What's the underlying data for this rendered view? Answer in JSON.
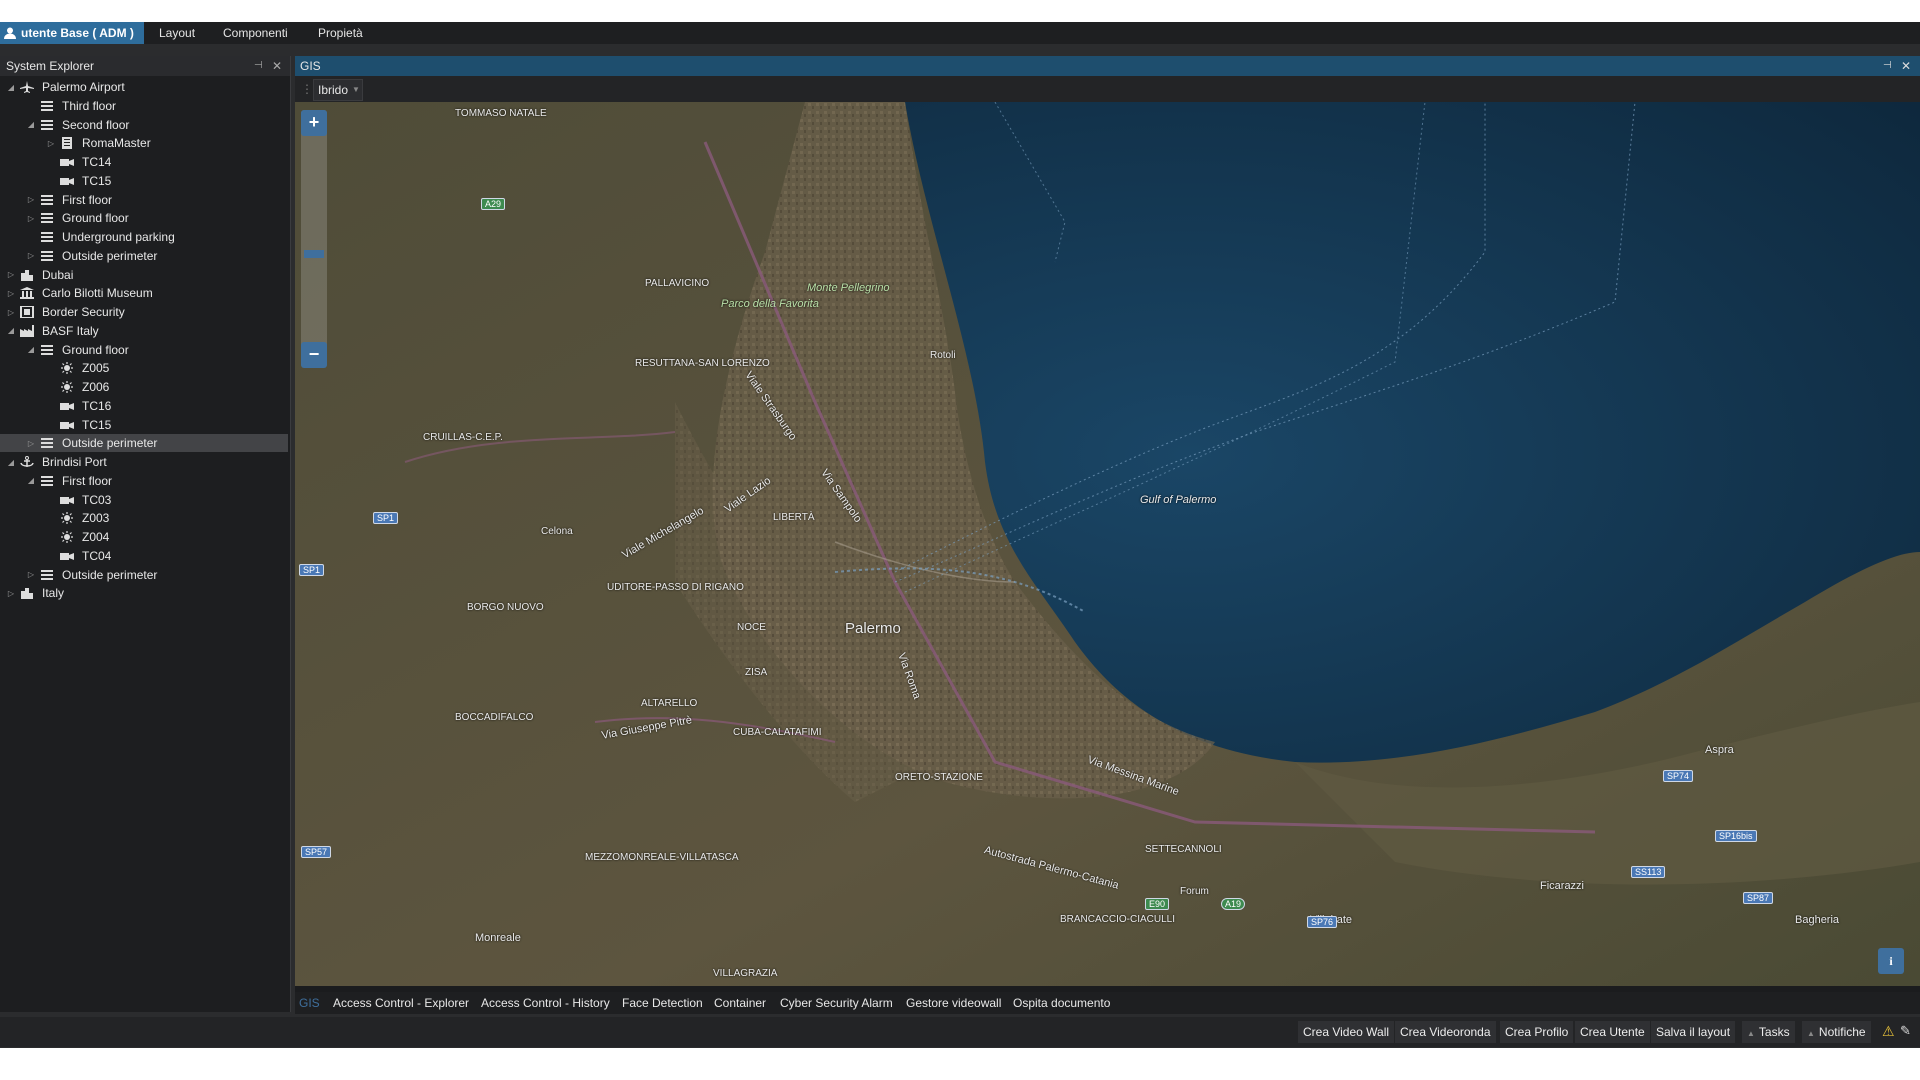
{
  "menubar": {
    "user_label": "utente  Base ( ADM )",
    "items": [
      "Layout",
      "Componenti",
      "Propietà"
    ]
  },
  "explorer": {
    "title": "System Explorer",
    "tree": [
      {
        "label": "Palermo Airport",
        "icon": "airplane-icon",
        "level": 0,
        "expanded": true
      },
      {
        "label": "Third floor",
        "icon": "floor-icon",
        "level": 1,
        "expanded": null
      },
      {
        "label": "Second floor",
        "icon": "floor-icon",
        "level": 1,
        "expanded": true
      },
      {
        "label": "RomaMaster",
        "icon": "server-icon",
        "level": 2,
        "expanded": false
      },
      {
        "label": "TC14",
        "icon": "camera-icon",
        "level": 2,
        "expanded": null
      },
      {
        "label": "TC15",
        "icon": "camera-icon",
        "level": 2,
        "expanded": null
      },
      {
        "label": "First floor",
        "icon": "floor-icon",
        "level": 1,
        "expanded": false
      },
      {
        "label": "Ground floor",
        "icon": "floor-icon",
        "level": 1,
        "expanded": false
      },
      {
        "label": "Underground parking",
        "icon": "floor-icon",
        "level": 1,
        "expanded": null
      },
      {
        "label": "Outside perimeter",
        "icon": "floor-icon",
        "level": 1,
        "expanded": false
      },
      {
        "label": "Dubai",
        "icon": "city-icon",
        "level": 0,
        "expanded": false
      },
      {
        "label": "Carlo Bilotti Museum",
        "icon": "museum-icon",
        "level": 0,
        "expanded": false
      },
      {
        "label": "Border Security",
        "icon": "border-icon",
        "level": 0,
        "expanded": false
      },
      {
        "label": "BASF Italy",
        "icon": "factory-icon",
        "level": 0,
        "expanded": true
      },
      {
        "label": "Ground floor",
        "icon": "floor-icon",
        "level": 1,
        "expanded": true
      },
      {
        "label": "Z005",
        "icon": "sensor-icon",
        "level": 2,
        "expanded": null
      },
      {
        "label": "Z006",
        "icon": "sensor-icon",
        "level": 2,
        "expanded": null
      },
      {
        "label": "TC16",
        "icon": "camera-icon",
        "level": 2,
        "expanded": null
      },
      {
        "label": "TC15",
        "icon": "camera-icon",
        "level": 2,
        "expanded": null
      },
      {
        "label": "Outside perimeter",
        "icon": "floor-icon",
        "level": 1,
        "expanded": false,
        "selected": true
      },
      {
        "label": "Brindisi Port",
        "icon": "anchor-icon",
        "level": 0,
        "expanded": true
      },
      {
        "label": "First floor",
        "icon": "floor-icon",
        "level": 1,
        "expanded": true
      },
      {
        "label": "TC03",
        "icon": "camera-icon",
        "level": 2,
        "expanded": null
      },
      {
        "label": "Z003",
        "icon": "sensor-icon",
        "level": 2,
        "expanded": null
      },
      {
        "label": "Z004",
        "icon": "sensor-icon",
        "level": 2,
        "expanded": null
      },
      {
        "label": "TC04",
        "icon": "camera-icon",
        "level": 2,
        "expanded": null
      },
      {
        "label": "Outside perimeter",
        "icon": "floor-icon",
        "level": 1,
        "expanded": false
      },
      {
        "label": "Italy",
        "icon": "city-icon",
        "level": 0,
        "expanded": false
      }
    ]
  },
  "gis": {
    "title": "GIS",
    "map_type": "Ibrido",
    "map_labels": {
      "city": "Palermo",
      "gulf": "Gulf of Palermo",
      "park": "Parco della Favorita",
      "mount": "Monte Pellegrino",
      "street1": "Viale Michelangelo",
      "street2": "Via Messina Marine",
      "street3": "Viale Lazio",
      "street4": "Via Sampolo",
      "street5": "Via Roma",
      "street6": "Viale Strasburgo",
      "street7": "Autostrada Palermo-Catania",
      "street8": "Via Giuseppe Pitrè",
      "dist1": "PALLAVICINO",
      "dist2": "LIBERTÀ",
      "dist3": "NOCE",
      "dist4": "ZISA",
      "dist5": "ALTARELLO",
      "dist6": "CUBA-CALATAFIMI",
      "dist7": "ORETO-STAZIONE",
      "dist8": "SETTECANNOLI",
      "dist9": "MEZZOMONREALE-VILLATASCA",
      "dist10": "BORGO NUOVO",
      "dist11": "BOCCADIFALCO",
      "dist12": "RESUTTANA-SAN LORENZO",
      "dist13": "UDITORE-PASSO DI RIGANO",
      "dist14": "CRUILLAS-C.E.P.",
      "dist15": "TOMMASO NATALE",
      "dist16": "BRANCACCIO-CIACULLI",
      "dist17": "VILLAGRAZIA",
      "town1": "Monreale",
      "town2": "Villabate",
      "town3": "Ficarazzi",
      "town4": "Bagheria",
      "town5": "Aspra",
      "town6": "Forum",
      "town7": "Celona",
      "town8": "Rotoli"
    },
    "road_signs": [
      "A29",
      "SP1",
      "SP1",
      "SP57",
      "E90",
      "A19",
      "SP76",
      "SS113",
      "SP74",
      "SP16bis",
      "SP87"
    ]
  },
  "tabs": [
    "GIS",
    "Access Control - Explorer",
    "Access Control - History",
    "Face Detection",
    "Container",
    "Cyber Security Alarm",
    "Gestore videowall",
    "Ospita documento"
  ],
  "statusbar": {
    "buttons": [
      "Crea Video Wall",
      "Crea Videoronda",
      "Crea Profilo",
      "Crea Utente",
      "Salva il layout"
    ],
    "tasks": "Tasks",
    "notifications": "Notifiche"
  },
  "colors": {
    "accent": "#2e6d9c",
    "panel": "#1d1e20",
    "sea": "#123450",
    "land": "#5b5540"
  }
}
